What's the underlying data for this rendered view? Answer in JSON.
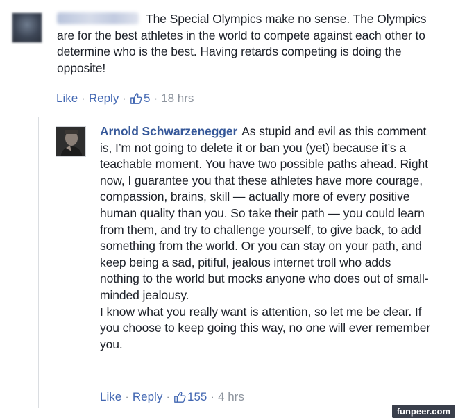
{
  "comments": [
    {
      "author": "",
      "text": "The Special Olympics make no sense. The Olympics are for the best athletes in the world to compete against each other to determine who is the best. Having retards competing is doing the opposite!",
      "like_label": "Like",
      "reply_label": "Reply",
      "reaction_count": "5",
      "timestamp": "18 hrs"
    },
    {
      "author": "Arnold Schwarzenegger",
      "text": "As stupid and evil as this comment is, I’m not going to delete it or ban you (yet) because it’s a teachable moment. You have two possible paths ahead. Right now, I guarantee you that these athletes have more courage, compassion, brains, skill — actually more of every positive human quality than you. So take their path — you could learn from them, and try to challenge yourself, to give back, to add something from the world. Or you can stay on your path, and keep being a sad, pitiful, jealous internet troll who adds nothing to the world but mocks anyone who does out of small-minded jealousy.",
      "text2": "I know what you really want is attention, so let me be clear. If you choose to keep going this way, no one will ever remember you.",
      "like_label": "Like",
      "reply_label": "Reply",
      "reaction_count": "155",
      "timestamp": "4 hrs"
    }
  ],
  "watermark": "funpeer.com",
  "colors": {
    "link": "#4267b2",
    "author": "#365899",
    "meta": "#8d949e",
    "text": "#1d2129"
  }
}
